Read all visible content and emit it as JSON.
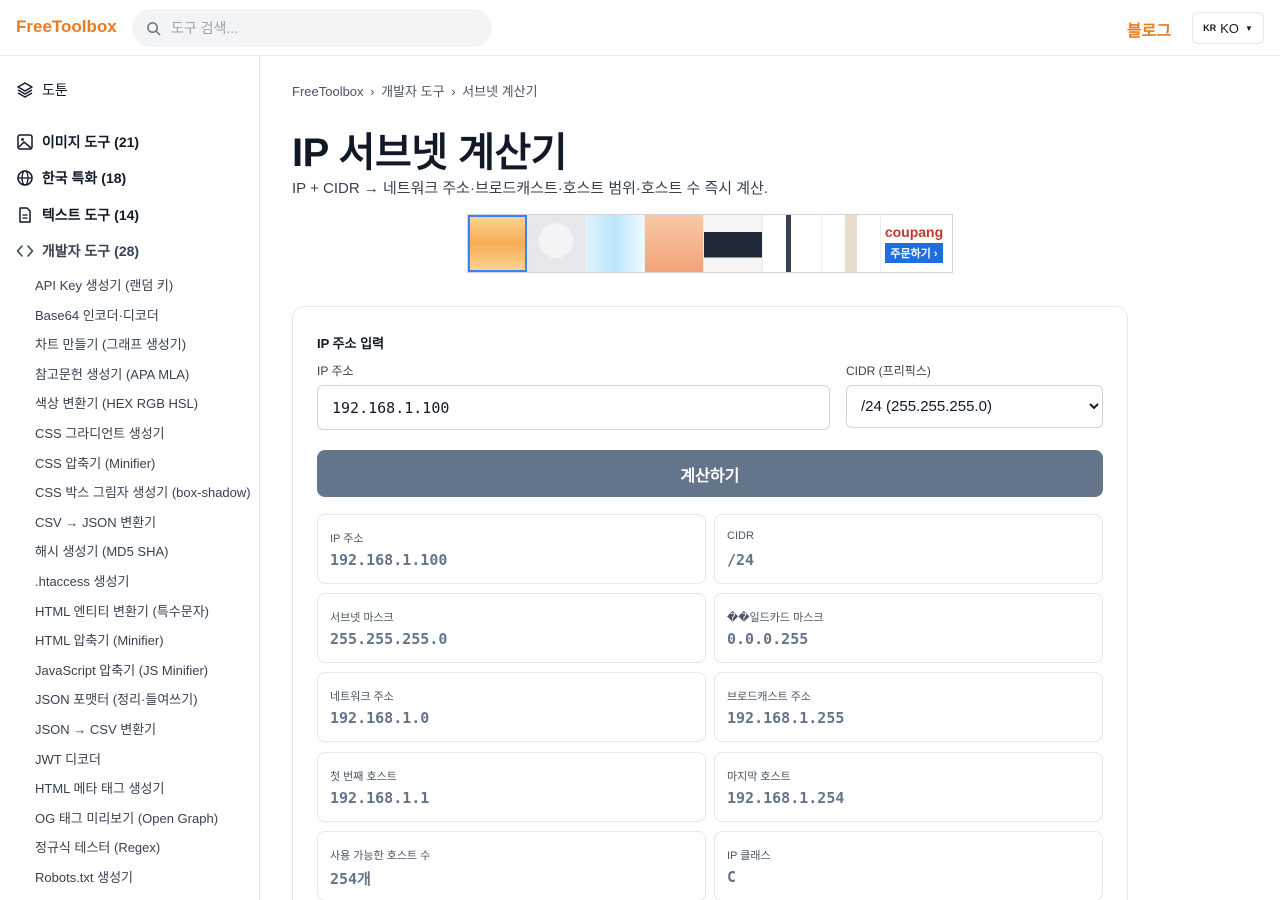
{
  "header": {
    "brand": "FreeToolbox",
    "search_placeholder": "도구 검색...",
    "blog": "블로그",
    "lang_flag": "KR",
    "lang": "KO"
  },
  "sidebar": {
    "all_tools": "도툰",
    "categories": [
      {
        "label": "이미지 도구 (21)",
        "icon": "image-icon"
      },
      {
        "label": "한국 특화 (18)",
        "icon": "globe-icon"
      },
      {
        "label": "텍스트 도구 (14)",
        "icon": "document-icon"
      },
      {
        "label": "개발자 도구 (28)",
        "icon": "code-icon"
      }
    ],
    "dev_items": [
      "API Key 생성기 (랜덤 키)",
      "Base64 인코더·디코더",
      "차트 만들기 (그래프 생성기)",
      "참고문헌 생성기 (APA MLA)",
      "색상 변환기 (HEX RGB HSL)",
      "CSS 그라디언트 생성기",
      "CSS 압축기 (Minifier)",
      "CSS 박스 그림자 생성기 (box-shadow)",
      "CSV → JSON 변환기",
      "해시 생성기 (MD5 SHA)",
      ".htaccess 생성기",
      "HTML 엔티티 변환기 (특수문자)",
      "HTML 압축기 (Minifier)",
      "JavaScript 압축기 (JS Minifier)",
      "JSON 포맷터 (정리·들여쓰기)",
      "JSON → CSV 변환기",
      "JWT 디코더",
      "HTML 메타 태그 생성기",
      "OG 태그 미리보기 (Open Graph)",
      "정규식 테스터 (Regex)",
      "Robots.txt 생성기"
    ]
  },
  "breadcrumb": {
    "home": "FreeToolbox",
    "category": "개발자 도구",
    "current": "서브넷 계산기",
    "sep": "›"
  },
  "page": {
    "title": "IP 서브넷 계산기",
    "description": "IP + CIDR → 네트워크 주소·브로드캐스트·호스트 범위·호스트 수 즉시 계산."
  },
  "ad": {
    "logo": "coupang",
    "order": "주문하기 ›"
  },
  "form": {
    "section_title": "IP 주소 입력",
    "ip_label": "IP 주소",
    "ip_value": "192.168.1.100",
    "cidr_label": "CIDR (프리픽스)",
    "cidr_selected": "/24 (255.255.255.0)",
    "calc_button": "계산하기"
  },
  "results": [
    {
      "label": "IP 주소",
      "value": "192.168.1.100"
    },
    {
      "label": "CIDR",
      "value": "/24"
    },
    {
      "label": "서브넷 마스크",
      "value": "255.255.255.0"
    },
    {
      "label": "��일드카드 마스크",
      "value": "0.0.0.255"
    },
    {
      "label": "네트워크 주소",
      "value": "192.168.1.0"
    },
    {
      "label": "브로드캐스트 주소",
      "value": "192.168.1.255"
    },
    {
      "label": "첫 번째 호스트",
      "value": "192.168.1.1"
    },
    {
      "label": "마지막 호스트",
      "value": "192.168.1.254"
    },
    {
      "label": "사용 가능한 호스트 수",
      "value": "254개"
    },
    {
      "label": "IP 클래스",
      "value": "C"
    }
  ],
  "colors": {
    "brand": "#ea7a1e",
    "button": "#64748b",
    "value": "#64748b"
  }
}
